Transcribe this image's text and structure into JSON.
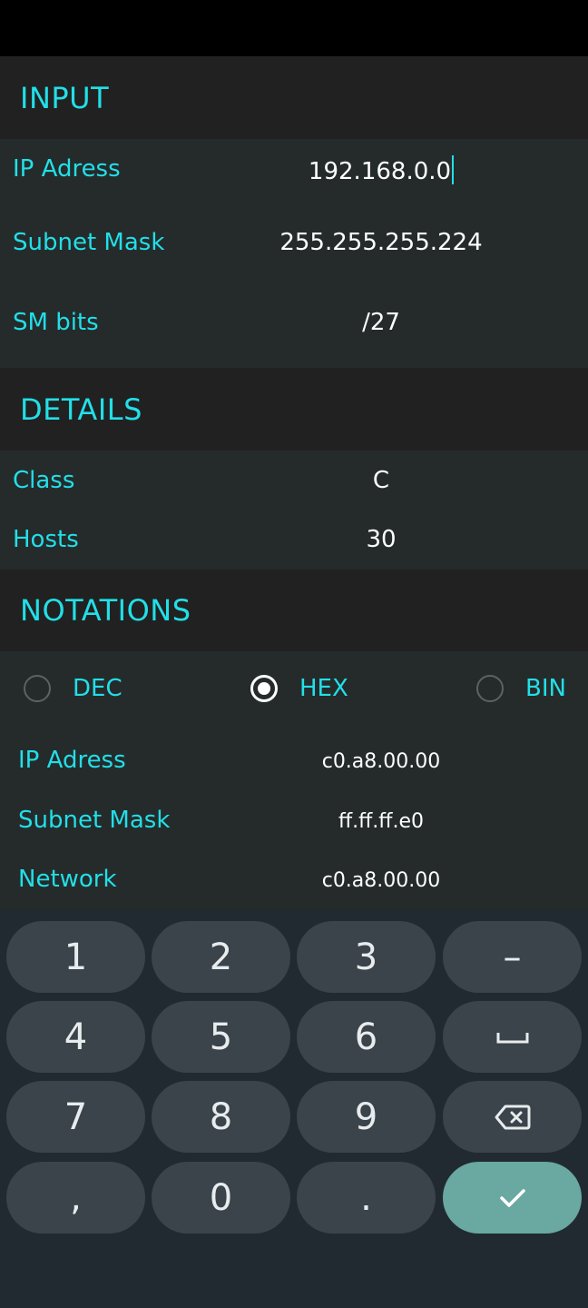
{
  "input": {
    "title": "INPUT",
    "ip_label": "IP Adress",
    "ip_value": "192.168.0.0",
    "mask_label": "Subnet Mask",
    "mask_value": "255.255.255.224",
    "bits_label": "SM bits",
    "bits_value": "/27"
  },
  "details": {
    "title": "DETAILS",
    "class_label": "Class",
    "class_value": "C",
    "hosts_label": "Hosts",
    "hosts_value": "30"
  },
  "notations": {
    "title": "NOTATIONS",
    "options": [
      "DEC",
      "HEX",
      "BIN"
    ],
    "selected": "HEX",
    "ip_label": "IP Adress",
    "ip_value": "c0.a8.00.00",
    "mask_label": "Subnet Mask",
    "mask_value": "ff.ff.ff.e0",
    "network_label": "Network",
    "network_value": "c0.a8.00.00"
  },
  "keyboard": {
    "keys": [
      "1",
      "2",
      "3",
      "–",
      "4",
      "5",
      "6",
      "space-icon",
      "7",
      "8",
      "9",
      "backspace-icon",
      ",",
      "0",
      ".",
      "check-icon"
    ]
  },
  "colors": {
    "accent": "#22dfe8",
    "header_bg": "#212121",
    "body_bg": "#252b2b",
    "key_bg": "#3a444a",
    "enter_key_bg": "#6aa8a2"
  }
}
